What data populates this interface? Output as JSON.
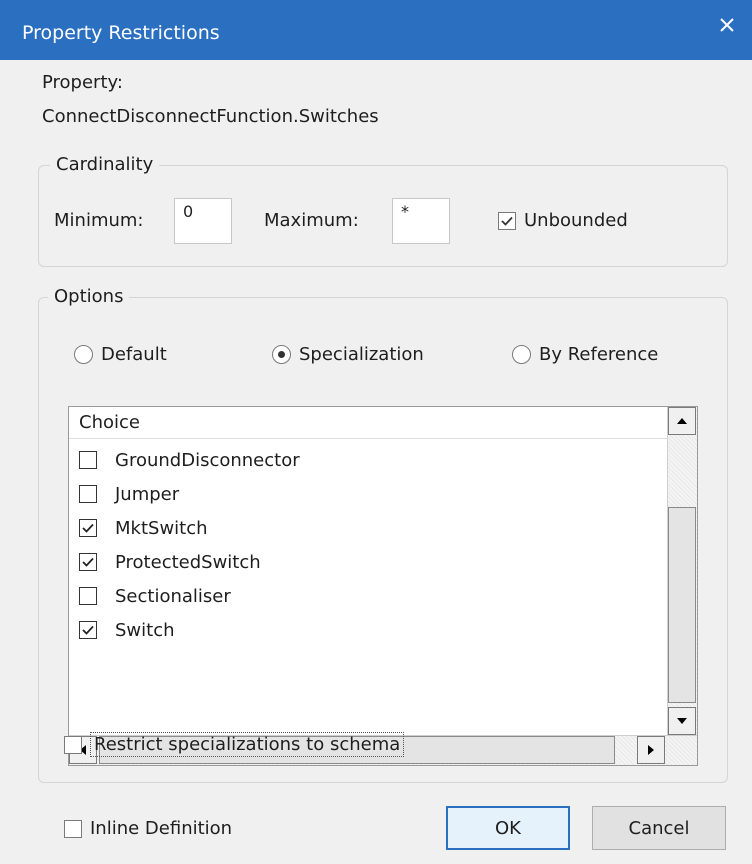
{
  "dialog": {
    "title": "Property Restrictions",
    "close_glyph": "×"
  },
  "property": {
    "label": "Property:",
    "value": "ConnectDisconnectFunction.Switches"
  },
  "cardinality": {
    "legend": "Cardinality",
    "minimum_label": "Minimum:",
    "minimum_value": "0",
    "maximum_label": "Maximum:",
    "maximum_value": "*",
    "unbounded_label": "Unbounded",
    "unbounded_checked": true
  },
  "options": {
    "legend": "Options",
    "radios": [
      {
        "label": "Default",
        "selected": false
      },
      {
        "label": "Specialization",
        "selected": true
      },
      {
        "label": "By Reference",
        "selected": false
      }
    ],
    "list_header": "Choice",
    "items": [
      {
        "label": "GroundDisconnector",
        "checked": false
      },
      {
        "label": "Jumper",
        "checked": false
      },
      {
        "label": "MktSwitch",
        "checked": true
      },
      {
        "label": "ProtectedSwitch",
        "checked": true
      },
      {
        "label": "Sectionaliser",
        "checked": false
      },
      {
        "label": "Switch",
        "checked": true
      }
    ],
    "restrict_label": "Restrict specializations to schema",
    "restrict_checked": false
  },
  "footer": {
    "inline_label": "Inline Definition",
    "inline_checked": false,
    "ok_label": "OK",
    "cancel_label": "Cancel"
  },
  "colors": {
    "titlebar": "#2a6fc0",
    "dialog_bg": "#f0f0f0",
    "default_button_border": "#2a6fc0"
  }
}
